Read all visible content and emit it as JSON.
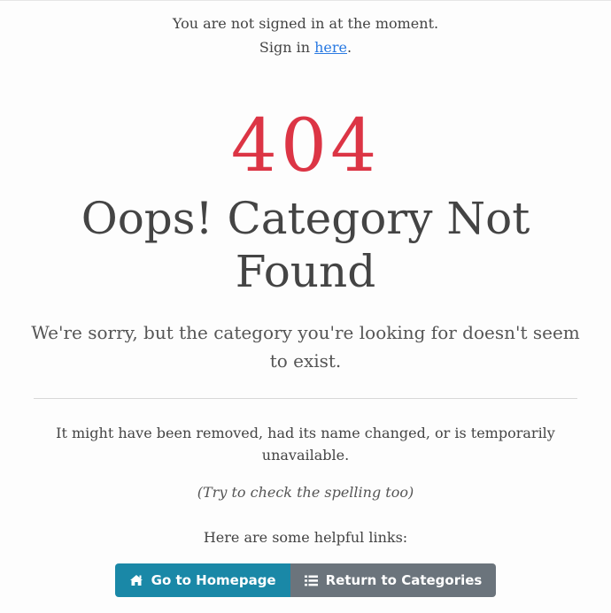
{
  "signin": {
    "message": "You are not signed in at the moment.",
    "prompt": "Sign in ",
    "link_text": "here",
    "suffix": "."
  },
  "error": {
    "code": "404",
    "title": "Oops! Category Not Found",
    "lead": "We're sorry, but the category you're looking for doesn't seem to exist.",
    "detail": "It might have been removed, had its name changed, or is temporarily unavailable.",
    "hint": "(Try to check the spelling too)",
    "helpful": "Here are some helpful links:"
  },
  "buttons": {
    "home": {
      "label": "Go to Homepage",
      "icon": "home-icon"
    },
    "categories": {
      "label": "Return to Categories",
      "icon": "list-icon"
    }
  },
  "colors": {
    "code": "#dc3545",
    "link": "#2a7ae2",
    "home_button": "#1a88a7",
    "categories_button": "#6b747c"
  }
}
